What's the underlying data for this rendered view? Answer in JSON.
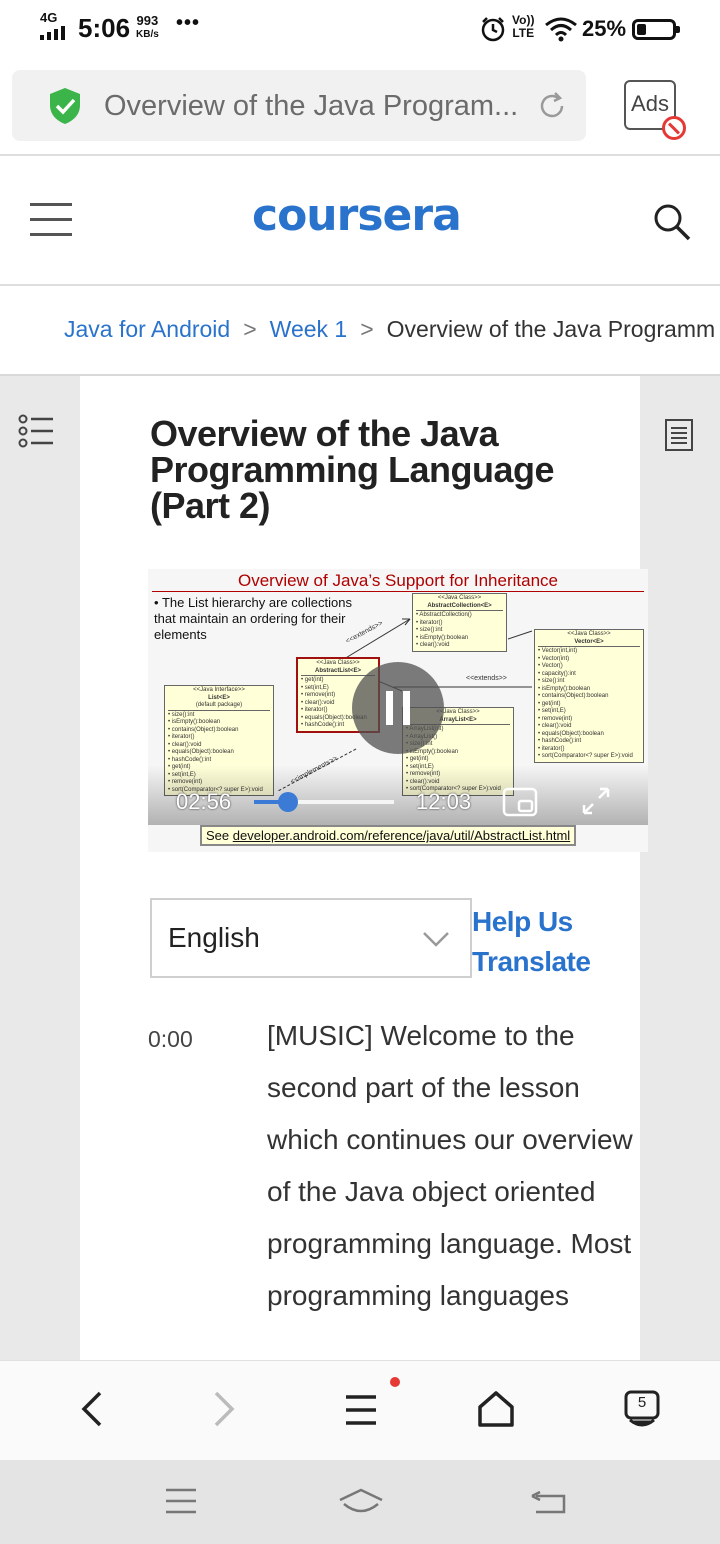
{
  "status_bar": {
    "network": "4G",
    "time": "5:06",
    "speed_value": "993",
    "speed_unit": "KB/s",
    "overflow": "•••",
    "volte_top": "Vo))",
    "volte_bottom": "LTE",
    "battery_pct": "25%",
    "battery_level": 0.25
  },
  "browser": {
    "url_title": "Overview of the Java Program...",
    "ads_label": "Ads",
    "tab_count": "5"
  },
  "header": {
    "logo": "coursera",
    "brand_color": "#2a73cc"
  },
  "breadcrumb": {
    "items": [
      "Java for Android",
      "Week 1",
      "Overview of the Java Programm"
    ]
  },
  "lesson": {
    "title": "Overview of the Java Programming Language (Part 2)"
  },
  "video": {
    "slide_title": "Overview of Java’s Support for Inheritance",
    "slide_bullet": "The List hierarchy are collections that maintain an ordering for their elements",
    "link_prefix": "See ",
    "link_url": "developer.android.com/reference/java/util/AbstractList.html",
    "current_time": "02:56",
    "duration": "12:03",
    "progress": 0.243,
    "state": "playing",
    "uml": {
      "abstract_collection": {
        "stereotype": "<<Java Class>>",
        "name": "AbstractCollection<E>",
        "members": [
          "AbstractCollection()",
          "iterator()",
          "size():int",
          "isEmpty():boolean",
          "clear():void"
        ]
      },
      "list": {
        "stereotype": "<<Java Interface>>",
        "name": "List<E>",
        "package": "(default package)",
        "members": [
          "size():int",
          "isEmpty():boolean",
          "contains(Object):boolean",
          "iterator()",
          "clear():void",
          "equals(Object):boolean",
          "hashCode():int",
          "get(int)",
          "set(int,E)",
          "remove(int)",
          "sort(Comparator<? super E>):void"
        ]
      },
      "abstract_list": {
        "stereotype": "<<Java Class>>",
        "name": "AbstractList<E>",
        "members": [
          "get(int)",
          "set(int,E)",
          "remove(int)",
          "clear():void",
          "iterator()",
          "equals(Object):boolean",
          "hashCode():int"
        ]
      },
      "array_list": {
        "stereotype": "<<Java Class>>",
        "name": "ArrayList<E>",
        "members": [
          "ArrayList(int)",
          "ArrayList()",
          "size():int",
          "isEmpty():boolean",
          "get(int)",
          "set(int,E)",
          "remove(int)",
          "clear():void",
          "sort(Comparator<? super E>):void"
        ]
      },
      "vector": {
        "stereotype": "<<Java Class>>",
        "name": "Vector<E>",
        "members": [
          "Vector(int,int)",
          "Vector(int)",
          "Vector()",
          "capacity():int",
          "size():int",
          "isEmpty():boolean",
          "contains(Object):boolean",
          "get(int)",
          "set(int,E)",
          "remove(int)",
          "clear():void",
          "equals(Object):boolean",
          "hashCode():int",
          "iterator()",
          "sort(Comparator<? super E>):void"
        ]
      },
      "rel_extends": "<<extends>>",
      "rel_implements": "<<implements>>"
    }
  },
  "language": {
    "selected": "English",
    "help_link": "Help Us Translate"
  },
  "transcript": {
    "time": "0:00",
    "text": "[MUSIC] Welcome to the second part of the lesson which continues our overview of the Java object oriented programming language. Most programming languages"
  }
}
